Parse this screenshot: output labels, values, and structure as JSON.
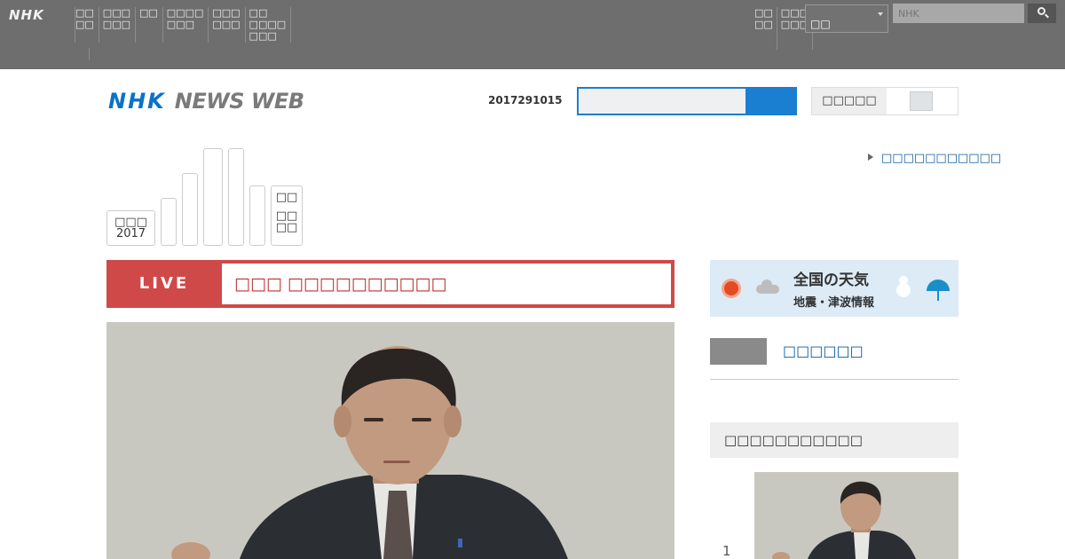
{
  "global_bar": {
    "logo": "NHK",
    "nav_items": [
      "□□\n□□",
      "□□□\n□□□",
      "□□",
      "□□□□\n□□□",
      "□□□\n□□□",
      "□□\n□□□□\n□□□"
    ],
    "right_items": [
      "□□\n□□",
      "□□□\n□□□"
    ],
    "select_value": "□□",
    "search_placeholder": "NHK",
    "search_icon": "search-icon"
  },
  "header": {
    "brand_nhk": "NHK",
    "brand_newsweb": "NEWS WEB",
    "date": "2017291015",
    "toggle_label": "□□□□□"
  },
  "right_link": "□□□□□□□□□□□",
  "date_tabs": [
    {
      "lines": [
        "□□□",
        "2017"
      ]
    },
    {
      "lines": []
    },
    {
      "lines": []
    },
    {
      "lines": []
    },
    {
      "lines": []
    },
    {
      "lines": []
    },
    {
      "lines": [
        "□□",
        "",
        "□□",
        "□□"
      ]
    }
  ],
  "live": {
    "tag": "LIVE",
    "headline": "□□□ □□□□□□□□□□"
  },
  "weather": {
    "title": "全国の天気",
    "subtitle": "地震・津波情報"
  },
  "video_link": "□□□□□□",
  "ranking": {
    "heading": "□□□□□□□□□□□",
    "first_rank": "1"
  },
  "colors": {
    "brand_blue": "#0a72c7",
    "live_red": "#d04949",
    "link_blue": "#0b5aa0"
  }
}
